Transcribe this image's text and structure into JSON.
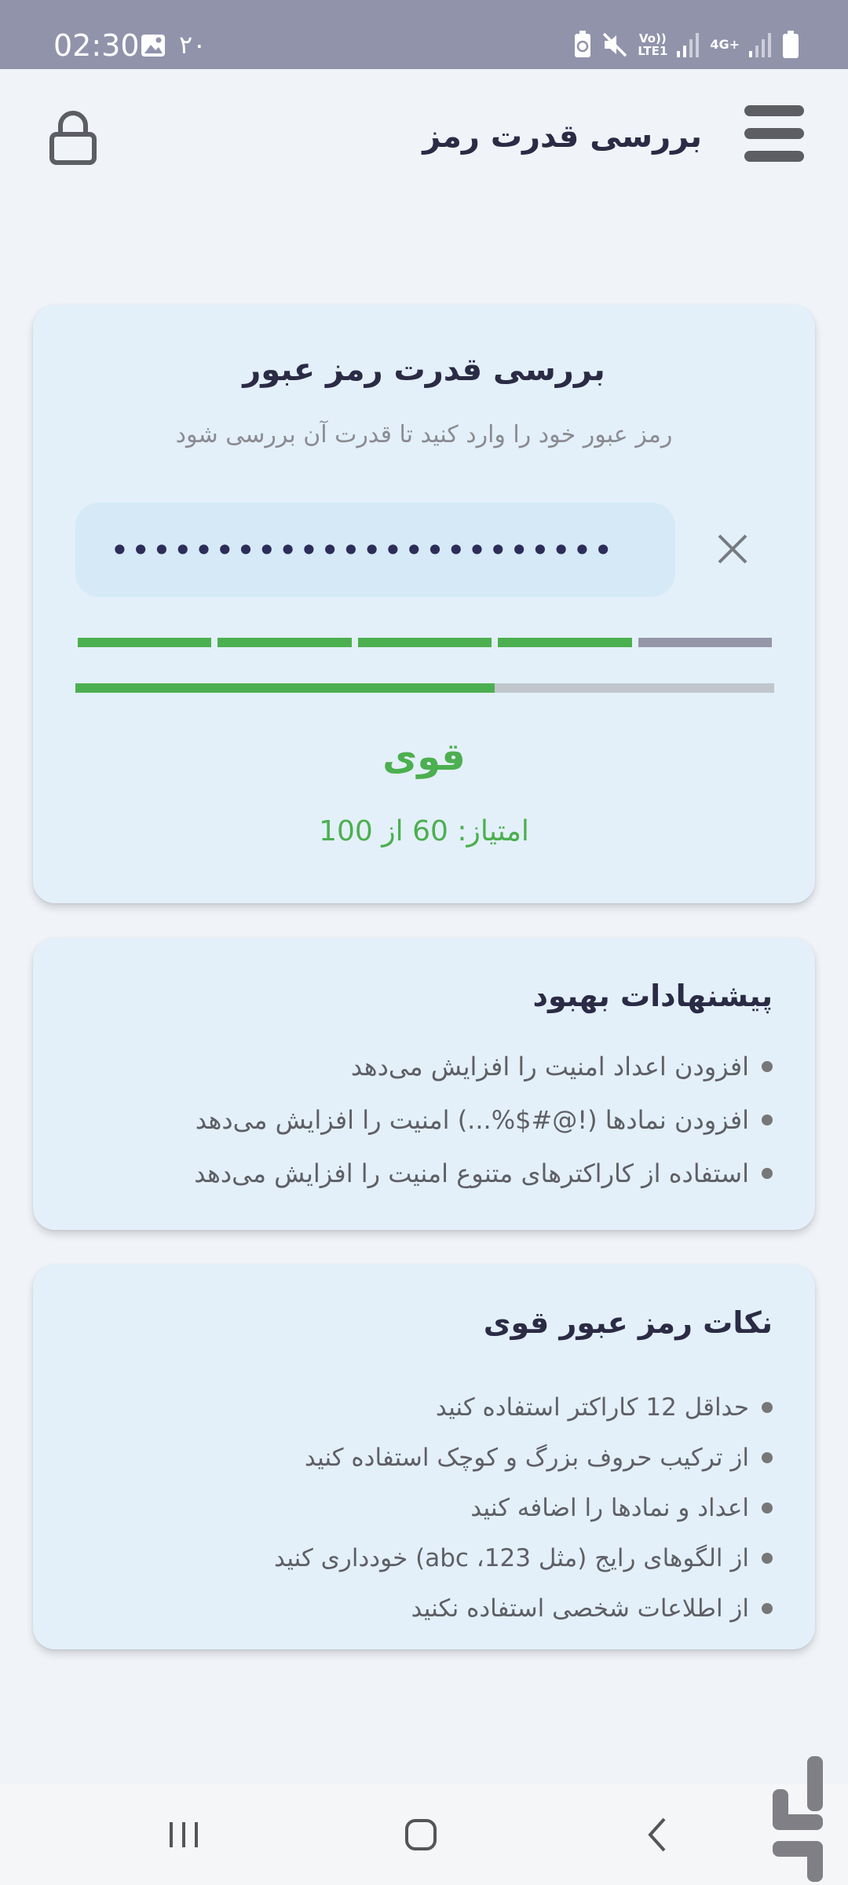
{
  "status_bar": {
    "time": "02:30",
    "notification_count": "۲۰",
    "network_top": "Vo))",
    "network_bottom": "LTE1",
    "network_type": "4G+",
    "icons": [
      "image-icon",
      "battery-saver-icon",
      "mute-icon",
      "signal-icon",
      "signal-icon",
      "battery-icon"
    ]
  },
  "app_bar": {
    "title": "بررسی قدرت رمز",
    "menu_icon": "hamburger-menu-icon",
    "lock_icon": "lock-icon"
  },
  "checker": {
    "title": "بررسی قدرت رمز عبور",
    "subtitle": "رمز عبور خود را وارد کنید تا قدرت آن بررسی شود",
    "password_masked": "••••••••••••••••••••••••",
    "segments_filled": 4,
    "segments_total": 5,
    "progress_fraction": 0.6,
    "strength_label": "قوی",
    "score_text": "امتیاز: 60 از 100",
    "colors": {
      "strong": "#4caf50",
      "inactive_segment": "#9596a8",
      "track": "#c1c6cd"
    }
  },
  "suggestions": {
    "title": "پیشنهادات بهبود",
    "items": [
      "افزودن اعداد امنیت را افزایش می‌دهد",
      "افزودن نمادها (!@#$%...) امنیت را افزایش می‌دهد",
      "استفاده از کاراکترهای متنوع امنیت را افزایش می‌دهد"
    ]
  },
  "tips": {
    "title": "نکات رمز عبور قوی",
    "items": [
      "حداقل 12 کاراکتر استفاده کنید",
      "از ترکیب حروف بزرگ و کوچک استفاده کنید",
      "اعداد و نمادها را اضافه کنید",
      "از الگوهای رایج (مثل 123، abc) خودداری کنید",
      "از اطلاعات شخصی استفاده نکنید"
    ]
  },
  "nav_bar": {
    "icons": [
      "recent-apps-icon",
      "home-icon",
      "back-icon"
    ]
  }
}
